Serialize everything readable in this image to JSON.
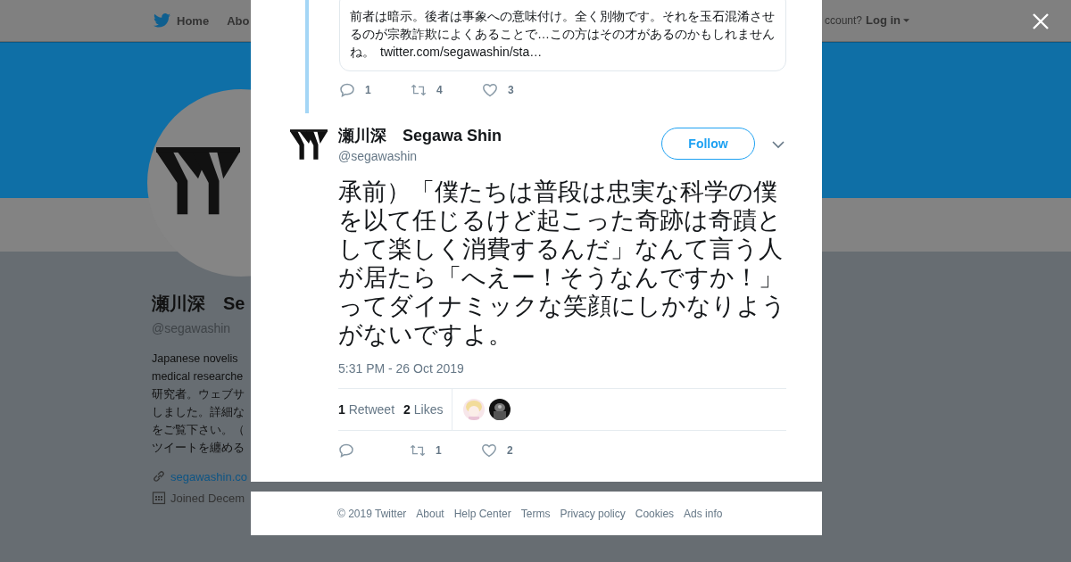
{
  "nav": {
    "items": [
      {
        "label": "Home",
        "kind": "home"
      },
      {
        "label": "Abo",
        "kind": "text"
      }
    ],
    "account_prompt": "ccount?",
    "login": "Log in"
  },
  "profile": {
    "name": "瀬川深　Se",
    "handle": "@segawashin",
    "bio_lines": [
      "Japanese novelis",
      "medical researche",
      "研究者。ウェブサ",
      "しました。詳細な",
      "をご覧下さい。（",
      "ツイートを纏める"
    ],
    "website": "segawashin.co",
    "joined": "Joined Decem"
  },
  "modal": {
    "previous_tweet": {
      "text": "前者は暗示。後者は事象への意味付け。全く別物です。それを玉石混淆させるのが宗教詐欺によくあることで…この方はその才があるのかもしれませんね。",
      "link": "twitter.com/segawashin/sta…",
      "actions": [
        {
          "kind": "reply",
          "count": "1"
        },
        {
          "kind": "retweet",
          "count": "4"
        },
        {
          "kind": "like",
          "count": "3"
        }
      ]
    },
    "tweet": {
      "name": "瀬川深　Segawa Shin",
      "handle": "@segawashin",
      "follow": "Follow",
      "text": "承前）「僕たちは普段は忠実な科学の僕を以て任じるけど起こった奇跡は奇蹟として楽しく消費するんだ」なんて言う人が居たら「へえー！そうなんですか！」ってダイナミックな笑顔にしかなりようがないですよ。",
      "time": "5:31 PM - 26 Oct 2019",
      "stats": [
        {
          "count": "1",
          "label": "Retweet"
        },
        {
          "count": "2",
          "label": "Likes"
        }
      ],
      "actions": [
        {
          "kind": "reply"
        },
        {
          "kind": "retweet",
          "count": "1"
        },
        {
          "kind": "like",
          "count": "2"
        }
      ]
    },
    "footer": [
      "© 2019 Twitter",
      "About",
      "Help Center",
      "Terms",
      "Privacy policy",
      "Cookies",
      "Ads info"
    ]
  }
}
